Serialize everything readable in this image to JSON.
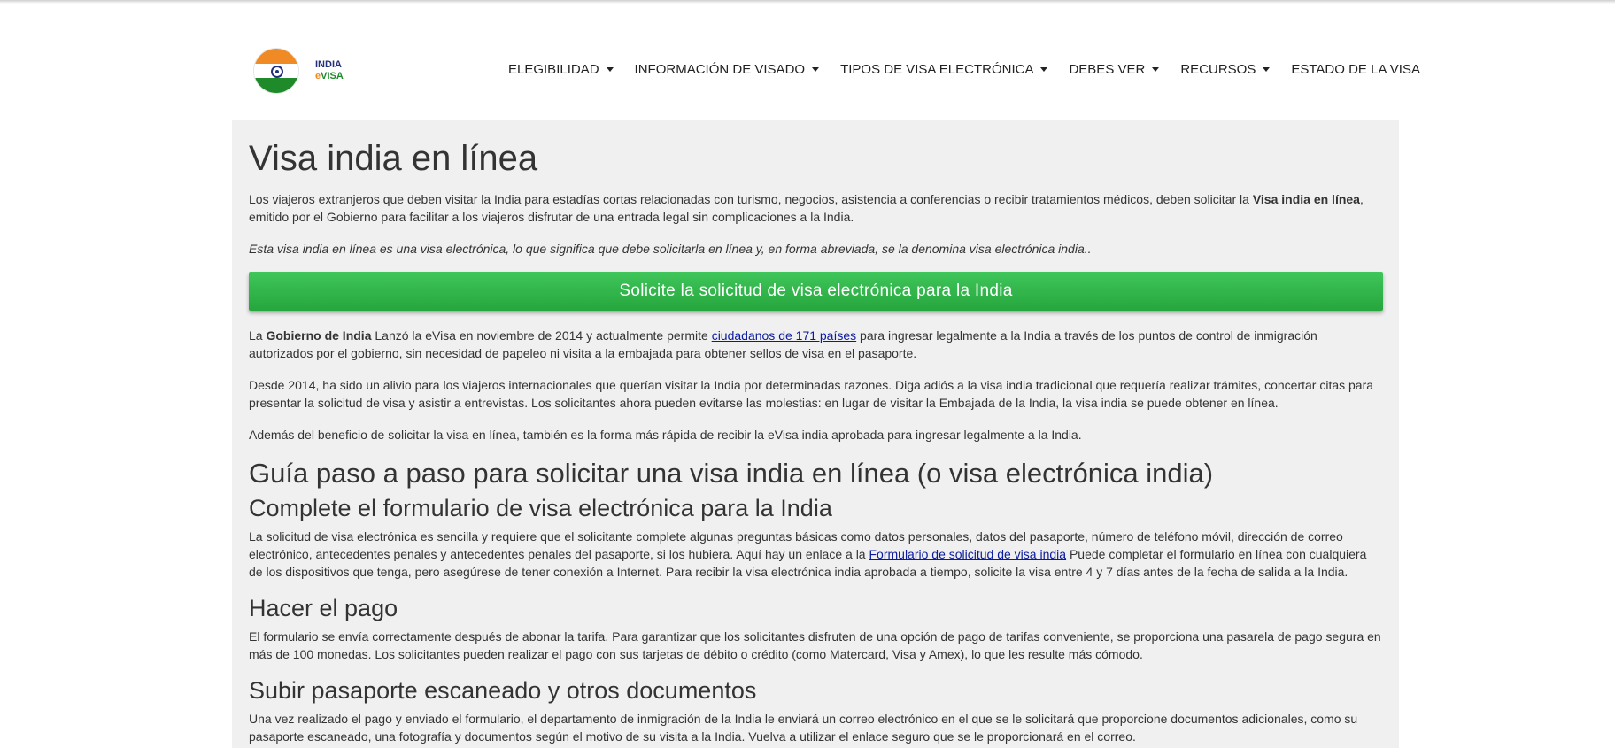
{
  "logo": {
    "line1": "INDIA",
    "line2_prefix": "e",
    "line2_suffix": "VISA"
  },
  "nav": [
    {
      "label": "ELEGIBILIDAD",
      "dropdown": true
    },
    {
      "label": "INFORMACIÓN DE VISADO",
      "dropdown": true
    },
    {
      "label": "TIPOS DE VISA ELECTRÓNICA",
      "dropdown": true
    },
    {
      "label": "DEBES VER",
      "dropdown": true
    },
    {
      "label": "RECURSOS",
      "dropdown": true
    },
    {
      "label": "ESTADO DE LA VISA",
      "dropdown": false
    }
  ],
  "main": {
    "title": "Visa india en línea",
    "intro_before": "Los viajeros extranjeros que deben visitar la India para estadías cortas relacionadas con turismo, negocios, asistencia a conferencias o recibir tratamientos médicos, deben solicitar la ",
    "intro_bold": "Visa india en línea",
    "intro_after": ", emitido por el Gobierno para facilitar a los viajeros disfrutar de una entrada legal sin complicaciones a la India.",
    "italic_note": "Esta visa india en línea es una visa electrónica, lo que significa que debe solicitarla en línea y, en forma abreviada, se la denomina visa electrónica india..",
    "cta_label": "Solicite la solicitud de visa electrónica para la India",
    "p2_before": "La ",
    "p2_bold": "Gobierno de India",
    "p2_mid": " Lanzó la eVisa en noviembre de 2014 y actualmente permite ",
    "p2_link": "ciudadanos de 171 países",
    "p2_after": " para ingresar legalmente a la India a través de los puntos de control de inmigración autorizados por el gobierno, sin necesidad de papeleo ni visita a la embajada para obtener sellos de visa en el pasaporte.",
    "p3": "Desde 2014, ha sido un alivio para los viajeros internacionales que querían visitar la India por determinadas razones. Diga adiós a la visa india tradicional que requería realizar trámites, concertar citas para presentar la solicitud de visa y asistir a entrevistas. Los solicitantes ahora pueden evitarse las molestias: en lugar de visitar la Embajada de la India, la visa india se puede obtener en línea.",
    "p4": "Además del beneficio de solicitar la visa en línea, también es la forma más rápida de recibir la eVisa india aprobada para ingresar legalmente a la India.",
    "guide_heading": "Guía paso a paso para solicitar una visa india en línea (o visa electrónica india)",
    "step1_heading": "Complete el formulario de visa electrónica para la India",
    "step1_before": "La solicitud de visa electrónica es sencilla y requiere que el solicitante complete algunas preguntas básicas como datos personales, datos del pasaporte, número de teléfono móvil, dirección de correo electrónico, antecedentes penales y antecedentes penales del pasaporte, si los hubiera. Aquí hay un enlace a la ",
    "step1_link": "Formulario de solicitud de visa india",
    "step1_after": " Puede completar el formulario en línea con cualquiera de los dispositivos que tenga, pero asegúrese de tener conexión a Internet. Para recibir la visa electrónica india aprobada a tiempo, solicite la visa entre 4 y 7 días antes de la fecha de salida a la India.",
    "step2_heading": "Hacer el pago",
    "step2_text": "El formulario se envía correctamente después de abonar la tarifa. Para garantizar que los solicitantes disfruten de una opción de pago de tarifas conveniente, se proporciona una pasarela de pago segura en más de 100 monedas. Los solicitantes pueden realizar el pago con sus tarjetas de débito o crédito (como Matercard, Visa y Amex), lo que les resulte más cómodo.",
    "step3_heading": "Subir pasaporte escaneado y otros documentos",
    "step3_text": "Una vez realizado el pago y enviado el formulario, el departamento de inmigración de la India le enviará un correo electrónico en el que se le solicitará que proporcione documentos adicionales, como su pasaporte escaneado, una fotografía y documentos según el motivo de su visita a la India. Vuelva a utilizar el enlace seguro que se le proporcionará en el correo."
  },
  "colors": {
    "cta_green": "#2fb548",
    "link_blue": "#0a1a9e",
    "content_bg": "#f0f0f0",
    "flag_saffron": "#f08a24",
    "flag_green": "#1f8a2a",
    "flag_navy": "#22317a"
  }
}
